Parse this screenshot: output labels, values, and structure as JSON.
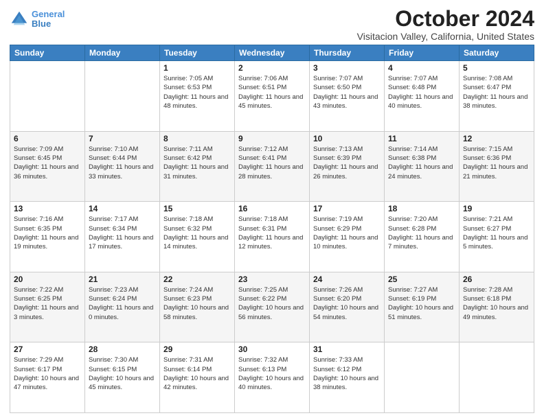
{
  "header": {
    "logo_line1": "General",
    "logo_line2": "Blue",
    "month": "October 2024",
    "location": "Visitacion Valley, California, United States"
  },
  "weekdays": [
    "Sunday",
    "Monday",
    "Tuesday",
    "Wednesday",
    "Thursday",
    "Friday",
    "Saturday"
  ],
  "weeks": [
    [
      {
        "day": "",
        "sunrise": "",
        "sunset": "",
        "daylight": ""
      },
      {
        "day": "",
        "sunrise": "",
        "sunset": "",
        "daylight": ""
      },
      {
        "day": "1",
        "sunrise": "Sunrise: 7:05 AM",
        "sunset": "Sunset: 6:53 PM",
        "daylight": "Daylight: 11 hours and 48 minutes."
      },
      {
        "day": "2",
        "sunrise": "Sunrise: 7:06 AM",
        "sunset": "Sunset: 6:51 PM",
        "daylight": "Daylight: 11 hours and 45 minutes."
      },
      {
        "day": "3",
        "sunrise": "Sunrise: 7:07 AM",
        "sunset": "Sunset: 6:50 PM",
        "daylight": "Daylight: 11 hours and 43 minutes."
      },
      {
        "day": "4",
        "sunrise": "Sunrise: 7:07 AM",
        "sunset": "Sunset: 6:48 PM",
        "daylight": "Daylight: 11 hours and 40 minutes."
      },
      {
        "day": "5",
        "sunrise": "Sunrise: 7:08 AM",
        "sunset": "Sunset: 6:47 PM",
        "daylight": "Daylight: 11 hours and 38 minutes."
      }
    ],
    [
      {
        "day": "6",
        "sunrise": "Sunrise: 7:09 AM",
        "sunset": "Sunset: 6:45 PM",
        "daylight": "Daylight: 11 hours and 36 minutes."
      },
      {
        "day": "7",
        "sunrise": "Sunrise: 7:10 AM",
        "sunset": "Sunset: 6:44 PM",
        "daylight": "Daylight: 11 hours and 33 minutes."
      },
      {
        "day": "8",
        "sunrise": "Sunrise: 7:11 AM",
        "sunset": "Sunset: 6:42 PM",
        "daylight": "Daylight: 11 hours and 31 minutes."
      },
      {
        "day": "9",
        "sunrise": "Sunrise: 7:12 AM",
        "sunset": "Sunset: 6:41 PM",
        "daylight": "Daylight: 11 hours and 28 minutes."
      },
      {
        "day": "10",
        "sunrise": "Sunrise: 7:13 AM",
        "sunset": "Sunset: 6:39 PM",
        "daylight": "Daylight: 11 hours and 26 minutes."
      },
      {
        "day": "11",
        "sunrise": "Sunrise: 7:14 AM",
        "sunset": "Sunset: 6:38 PM",
        "daylight": "Daylight: 11 hours and 24 minutes."
      },
      {
        "day": "12",
        "sunrise": "Sunrise: 7:15 AM",
        "sunset": "Sunset: 6:36 PM",
        "daylight": "Daylight: 11 hours and 21 minutes."
      }
    ],
    [
      {
        "day": "13",
        "sunrise": "Sunrise: 7:16 AM",
        "sunset": "Sunset: 6:35 PM",
        "daylight": "Daylight: 11 hours and 19 minutes."
      },
      {
        "day": "14",
        "sunrise": "Sunrise: 7:17 AM",
        "sunset": "Sunset: 6:34 PM",
        "daylight": "Daylight: 11 hours and 17 minutes."
      },
      {
        "day": "15",
        "sunrise": "Sunrise: 7:18 AM",
        "sunset": "Sunset: 6:32 PM",
        "daylight": "Daylight: 11 hours and 14 minutes."
      },
      {
        "day": "16",
        "sunrise": "Sunrise: 7:18 AM",
        "sunset": "Sunset: 6:31 PM",
        "daylight": "Daylight: 11 hours and 12 minutes."
      },
      {
        "day": "17",
        "sunrise": "Sunrise: 7:19 AM",
        "sunset": "Sunset: 6:29 PM",
        "daylight": "Daylight: 11 hours and 10 minutes."
      },
      {
        "day": "18",
        "sunrise": "Sunrise: 7:20 AM",
        "sunset": "Sunset: 6:28 PM",
        "daylight": "Daylight: 11 hours and 7 minutes."
      },
      {
        "day": "19",
        "sunrise": "Sunrise: 7:21 AM",
        "sunset": "Sunset: 6:27 PM",
        "daylight": "Daylight: 11 hours and 5 minutes."
      }
    ],
    [
      {
        "day": "20",
        "sunrise": "Sunrise: 7:22 AM",
        "sunset": "Sunset: 6:25 PM",
        "daylight": "Daylight: 11 hours and 3 minutes."
      },
      {
        "day": "21",
        "sunrise": "Sunrise: 7:23 AM",
        "sunset": "Sunset: 6:24 PM",
        "daylight": "Daylight: 11 hours and 0 minutes."
      },
      {
        "day": "22",
        "sunrise": "Sunrise: 7:24 AM",
        "sunset": "Sunset: 6:23 PM",
        "daylight": "Daylight: 10 hours and 58 minutes."
      },
      {
        "day": "23",
        "sunrise": "Sunrise: 7:25 AM",
        "sunset": "Sunset: 6:22 PM",
        "daylight": "Daylight: 10 hours and 56 minutes."
      },
      {
        "day": "24",
        "sunrise": "Sunrise: 7:26 AM",
        "sunset": "Sunset: 6:20 PM",
        "daylight": "Daylight: 10 hours and 54 minutes."
      },
      {
        "day": "25",
        "sunrise": "Sunrise: 7:27 AM",
        "sunset": "Sunset: 6:19 PM",
        "daylight": "Daylight: 10 hours and 51 minutes."
      },
      {
        "day": "26",
        "sunrise": "Sunrise: 7:28 AM",
        "sunset": "Sunset: 6:18 PM",
        "daylight": "Daylight: 10 hours and 49 minutes."
      }
    ],
    [
      {
        "day": "27",
        "sunrise": "Sunrise: 7:29 AM",
        "sunset": "Sunset: 6:17 PM",
        "daylight": "Daylight: 10 hours and 47 minutes."
      },
      {
        "day": "28",
        "sunrise": "Sunrise: 7:30 AM",
        "sunset": "Sunset: 6:15 PM",
        "daylight": "Daylight: 10 hours and 45 minutes."
      },
      {
        "day": "29",
        "sunrise": "Sunrise: 7:31 AM",
        "sunset": "Sunset: 6:14 PM",
        "daylight": "Daylight: 10 hours and 42 minutes."
      },
      {
        "day": "30",
        "sunrise": "Sunrise: 7:32 AM",
        "sunset": "Sunset: 6:13 PM",
        "daylight": "Daylight: 10 hours and 40 minutes."
      },
      {
        "day": "31",
        "sunrise": "Sunrise: 7:33 AM",
        "sunset": "Sunset: 6:12 PM",
        "daylight": "Daylight: 10 hours and 38 minutes."
      },
      {
        "day": "",
        "sunrise": "",
        "sunset": "",
        "daylight": ""
      },
      {
        "day": "",
        "sunrise": "",
        "sunset": "",
        "daylight": ""
      }
    ]
  ]
}
